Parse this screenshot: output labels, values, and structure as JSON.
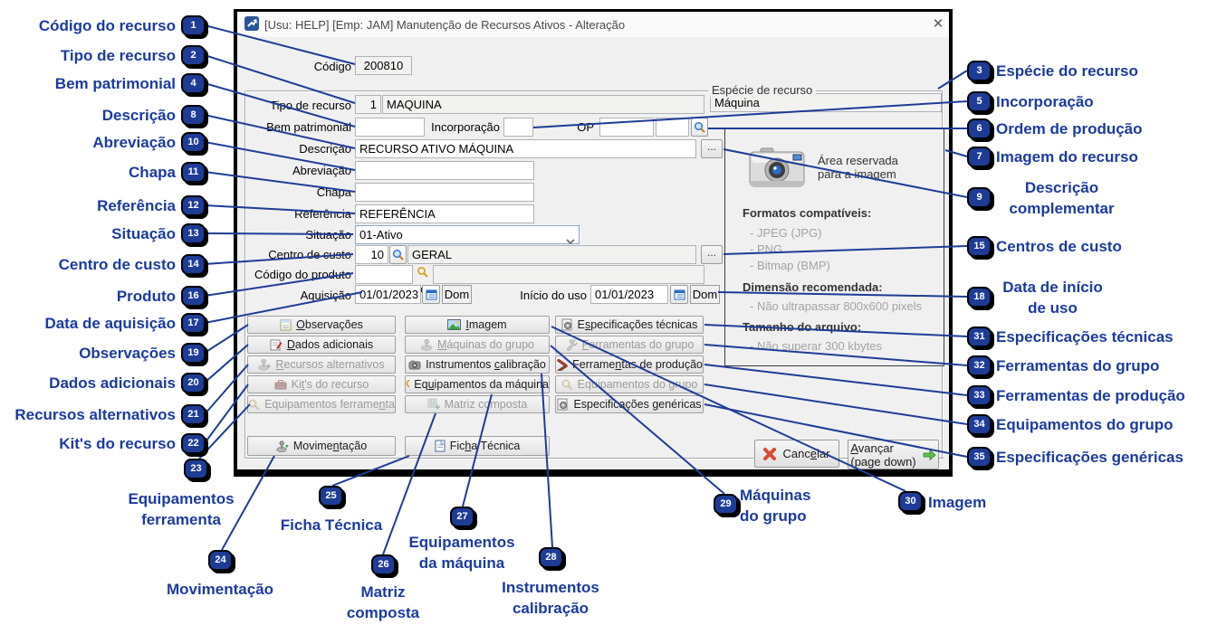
{
  "window": {
    "title": "[Usu: HELP] [Emp: JAM] Manutenção de Recursos Ativos - Alteração"
  },
  "form": {
    "codigo": {
      "label": "Código",
      "value": "200810"
    },
    "especie": {
      "legend": "Espécie de recurso",
      "value": "Máquina"
    },
    "tipo": {
      "label": "Tipo de recurso",
      "num": "1",
      "name": "MAQUINA"
    },
    "bem": {
      "label": "Bem patrimonial",
      "value": ""
    },
    "incorporacao": {
      "label": "Incorporação",
      "value": ""
    },
    "op": {
      "label": "OP",
      "value1": "",
      "value2": ""
    },
    "descricao": {
      "label": "Descrição",
      "value": "RECURSO ATIVO MÁQUINA",
      "more": "..."
    },
    "abreviacao": {
      "label": "Abreviação",
      "value": ""
    },
    "chapa": {
      "label": "Chapa",
      "value": ""
    },
    "referencia": {
      "label": "Referência",
      "value": "REFERÊNCIA"
    },
    "situacao": {
      "label": "Situação",
      "value": "01-Ativo"
    },
    "centro": {
      "label": "Centro de custo",
      "num": "10",
      "value": "GERAL",
      "more": "..."
    },
    "produto": {
      "label": "Código do produto",
      "value": "",
      "value2": ""
    },
    "aquisicao": {
      "label": "Aquisição",
      "value": "01/01/2023",
      "dow": "Dom"
    },
    "inicio": {
      "label": "Início do uso",
      "value": "01/01/2023",
      "dow": "Dom"
    }
  },
  "panel": {
    "reserved": "Área reservada\npara a imagem",
    "formats_title": "Formatos compatíveis:",
    "f1": "- JPEG (JPG)",
    "f2": "- PNG",
    "f3": "- Bitmap (BMP)",
    "dim_title": "Dimensão recomendada:",
    "dim": "- Não ultrapassar 800x600 pixels",
    "size_title": "Tamanho do arquivo:",
    "size": "- Não superar 300 kbytes"
  },
  "buttons": {
    "obs": "Observações",
    "dados": "Dados adicionais",
    "rec": "Recursos alternativos",
    "kits": "Kit's do recurso",
    "equipf": "Equipamentos ferramenta",
    "img": "Imagem",
    "maq": "Máquinas do grupo",
    "instr": "Instrumentos calibração",
    "equipm": "Equipamentos da máquina",
    "matriz": "Matriz composta",
    "espt": "Especificações técnicas",
    "ferg": "Ferramentas do grupo",
    "ferp": "Ferramentas de produção",
    "equig": "Equipamentos do grupo",
    "espg": "Especificações genéricas",
    "mov": "Movimentação",
    "ficha": "Ficha Técnica",
    "cancel": "Cancelar",
    "avancar1": "Avançar",
    "avancar2": "(page down)"
  },
  "callouts": {
    "c1": {
      "n": "1",
      "t": "Código do recurso"
    },
    "c2": {
      "n": "2",
      "t": "Tipo de recurso"
    },
    "c3": {
      "n": "3",
      "t": "Espécie do recurso"
    },
    "c4": {
      "n": "4",
      "t": "Bem patrimonial"
    },
    "c5": {
      "n": "5",
      "t": "Incorporação"
    },
    "c6": {
      "n": "6",
      "t": "Ordem de produção"
    },
    "c7": {
      "n": "7",
      "t": "Imagem do recurso"
    },
    "c8": {
      "n": "8",
      "t": "Descrição"
    },
    "c9": {
      "n": "9",
      "t": "Descrição\ncomplementar"
    },
    "c10": {
      "n": "10",
      "t": "Abreviação"
    },
    "c11": {
      "n": "11",
      "t": "Chapa"
    },
    "c12": {
      "n": "12",
      "t": "Referência"
    },
    "c13": {
      "n": "13",
      "t": "Situação"
    },
    "c14": {
      "n": "14",
      "t": "Centro de custo"
    },
    "c15": {
      "n": "15",
      "t": "Centros de custo"
    },
    "c16": {
      "n": "16",
      "t": "Produto"
    },
    "c17": {
      "n": "17",
      "t": "Data de aquisição"
    },
    "c18": {
      "n": "18",
      "t": "Data de início\nde uso"
    },
    "c19": {
      "n": "19",
      "t": "Observações"
    },
    "c20": {
      "n": "20",
      "t": "Dados adicionais"
    },
    "c21": {
      "n": "21",
      "t": "Recursos alternativos"
    },
    "c22": {
      "n": "22",
      "t": "Kit's do recurso"
    },
    "c23": {
      "n": "23",
      "t": "Equipamentos\nferramenta"
    },
    "c24": {
      "n": "24",
      "t": "Movimentação"
    },
    "c25": {
      "n": "25",
      "t": "Ficha Técnica"
    },
    "c26": {
      "n": "26",
      "t": "Matriz\ncomposta"
    },
    "c27": {
      "n": "27",
      "t": "Equipamentos\nda máquina"
    },
    "c28": {
      "n": "28",
      "t": "Instrumentos\ncalibração"
    },
    "c29": {
      "n": "29",
      "t": "Máquinas\ndo grupo"
    },
    "c30": {
      "n": "30",
      "t": "Imagem"
    },
    "c31": {
      "n": "31",
      "t": "Especificações técnicas"
    },
    "c32": {
      "n": "32",
      "t": "Ferramentas do grupo"
    },
    "c33": {
      "n": "33",
      "t": "Ferramentas de produção"
    },
    "c34": {
      "n": "34",
      "t": "Equipamentos do grupo"
    },
    "c35": {
      "n": "35",
      "t": "Especificações genéricas"
    }
  },
  "colors": {
    "accent_navy": "#1e3c96",
    "callout_text": "#1c3aa0",
    "dialog_bg": "#f0f0f0"
  }
}
